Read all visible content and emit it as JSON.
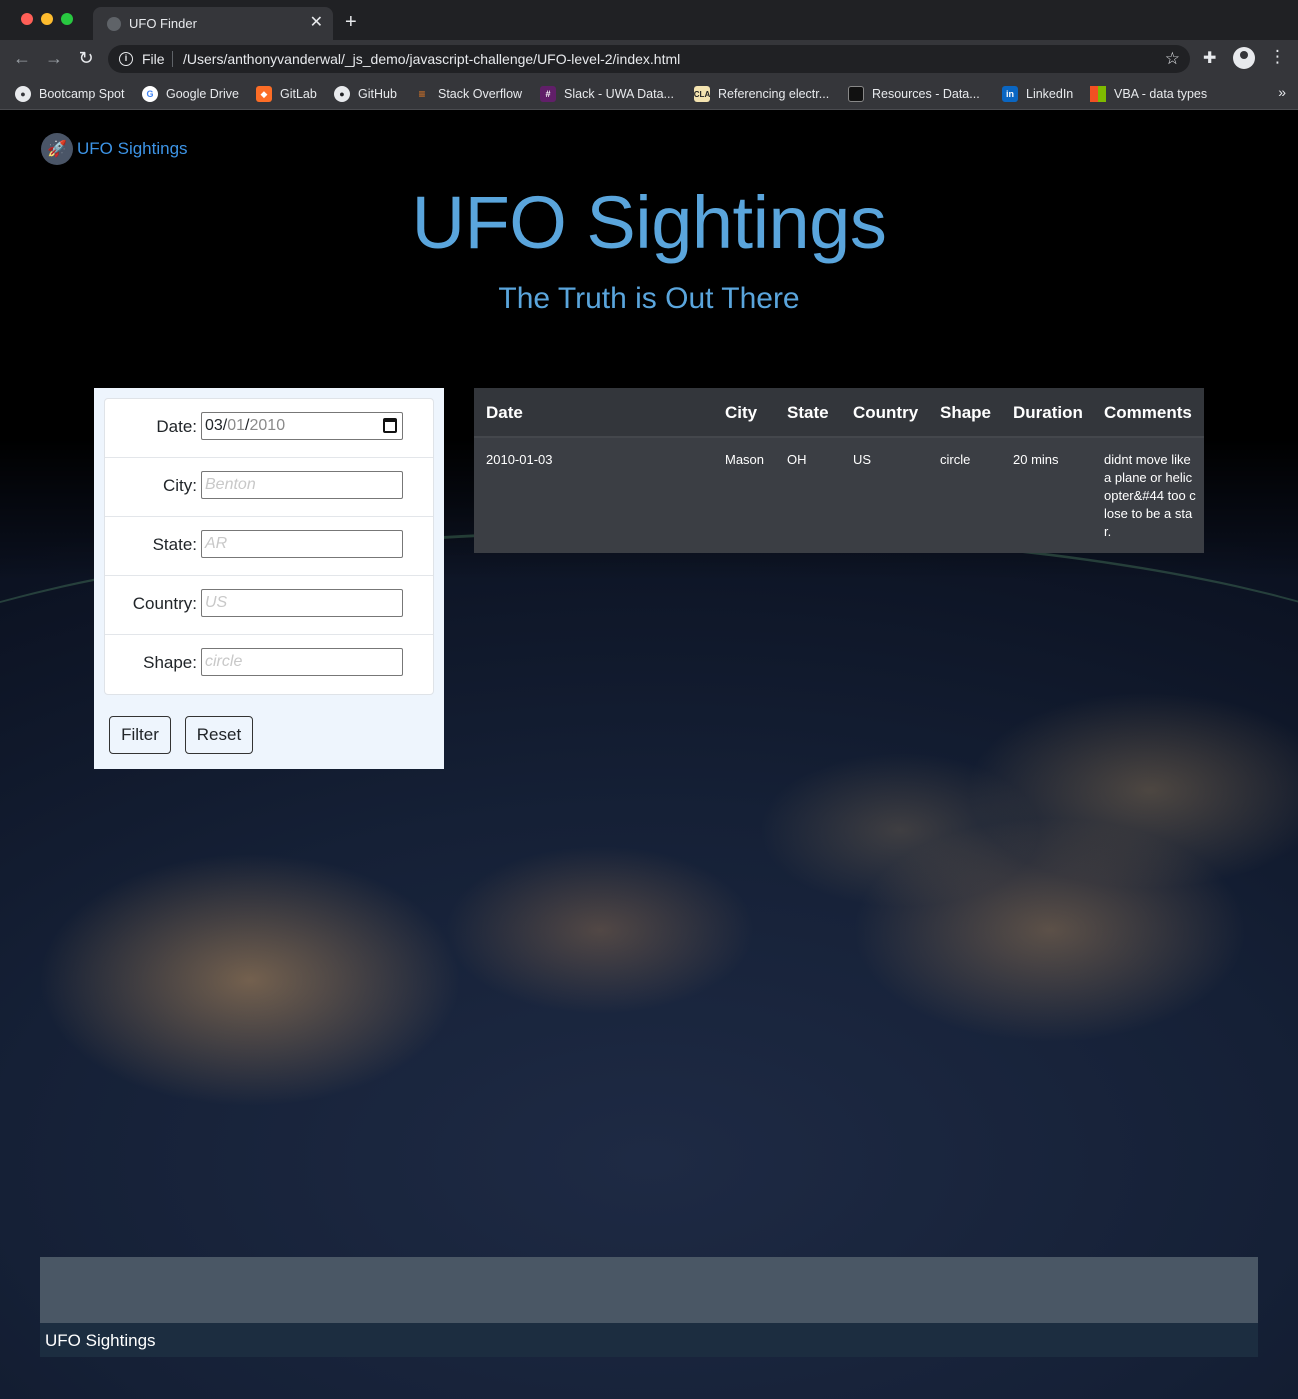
{
  "browser": {
    "tab_title": "UFO Finder",
    "url_scheme": "File",
    "url": "/Users/anthonyvanderwal/_js_demo/javascript-challenge/UFO-level-2/index.html",
    "bookmarks": [
      {
        "label": "Bootcamp Spot",
        "icon": "globe-icon",
        "color": "#e8eaed"
      },
      {
        "label": "Google Drive",
        "icon": "google-icon",
        "color": "#ffffff"
      },
      {
        "label": "GitLab",
        "icon": "gitlab-icon",
        "color": "#fc6d26"
      },
      {
        "label": "GitHub",
        "icon": "github-icon",
        "color": "#e8eaed"
      },
      {
        "label": "Stack Overflow",
        "icon": "stackoverflow-icon",
        "color": "#f48024"
      },
      {
        "label": "Slack - UWA Data...",
        "icon": "slack-icon",
        "color": "#611f69"
      },
      {
        "label": "Referencing electr...",
        "icon": "cla-icon",
        "color": "#d4a03a"
      },
      {
        "label": "Resources - Data...",
        "icon": "book-icon",
        "color": "#2a2a2a"
      },
      {
        "label": "LinkedIn",
        "icon": "linkedin-icon",
        "color": "#0a66c2"
      },
      {
        "label": "VBA - data types",
        "icon": "microsoft-icon",
        "color": "#f25022"
      }
    ]
  },
  "page": {
    "brand": "UFO Sightings",
    "title": "UFO Sightings",
    "subtitle": "The Truth is Out There",
    "accent_color": "#5aa5dc",
    "filters": [
      {
        "label": "Date:",
        "placeholder": "",
        "value_month": "03",
        "value_day": "01",
        "value_year": "2010"
      },
      {
        "label": "City:",
        "placeholder": "Benton"
      },
      {
        "label": "State:",
        "placeholder": "AR"
      },
      {
        "label": "Country:",
        "placeholder": "US"
      },
      {
        "label": "Shape:",
        "placeholder": "circle"
      }
    ],
    "buttons": {
      "filter": "Filter",
      "reset": "Reset"
    },
    "table": {
      "headers": [
        "Date",
        "City",
        "State",
        "Country",
        "Shape",
        "Duration",
        "Comments"
      ],
      "rows": [
        [
          "2010-01-03",
          "Mason",
          "OH",
          "US",
          "circle",
          "20 mins",
          "didnt move like a plane or helicopter&#44 too close to be a star."
        ]
      ]
    },
    "footer": "UFO Sightings"
  }
}
